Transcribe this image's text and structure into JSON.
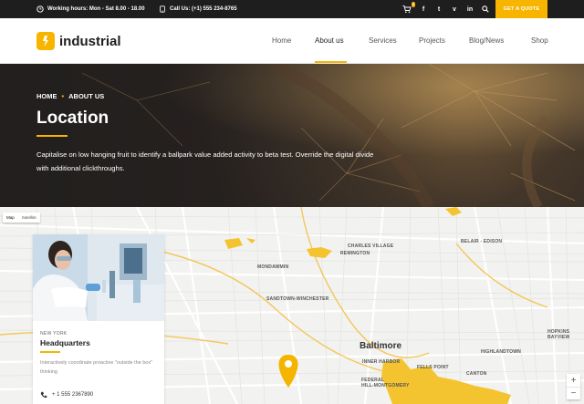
{
  "topbar": {
    "hours_text": "Working hours: Mon - Sat 8.00 - 18.00",
    "phone_text": "Call Us: (+1) 555 234-8765",
    "cart_count": "0",
    "social": [
      "f",
      "t",
      "v",
      "in"
    ],
    "quote_label": "GET A QUOTE"
  },
  "header": {
    "logo": "industrial",
    "nav": [
      "Home",
      "About us",
      "Services",
      "Projects",
      "Blog/News",
      "Shop"
    ],
    "active_nav": "About us"
  },
  "hero": {
    "breadcrumb": [
      "HOME",
      "ABOUT US"
    ],
    "title": "Location",
    "text": "Capitalise on low hanging fruit to identify a ballpark value added activity to beta test. Override the digital divide with additional clickthroughs."
  },
  "map": {
    "toggle": [
      "Map",
      "Satellite"
    ],
    "labels": {
      "charles_village": "CHARLES VILLAGE",
      "remington": "REMINGTON",
      "belair_edison": "BELAIR - EDISON",
      "mondawmin": "MONDAWMIN",
      "sandtown": "SANDTOWN-WINCHESTER",
      "hopkins_bayview": "HOPKINS\nBAYVIEW",
      "highlandtown": "HIGHLANDTOWN",
      "inner_harbor": "INNER HARBOR",
      "fells_point": "FELLS POINT",
      "canton": "CANTON",
      "federal_hill": "FEDERAL\nHILL-MONTGOMERY"
    },
    "city": "Baltimore",
    "zoom_in": "+",
    "zoom_out": "−"
  },
  "card": {
    "kicker": "NEW YORK",
    "title": "Headquarters",
    "text": "Interactively coordinate proactive \"outside the box\" thinking",
    "phone": "+ 1 555 2367890"
  },
  "colors": {
    "accent": "#f7b500",
    "dark": "#1e1e1e"
  }
}
